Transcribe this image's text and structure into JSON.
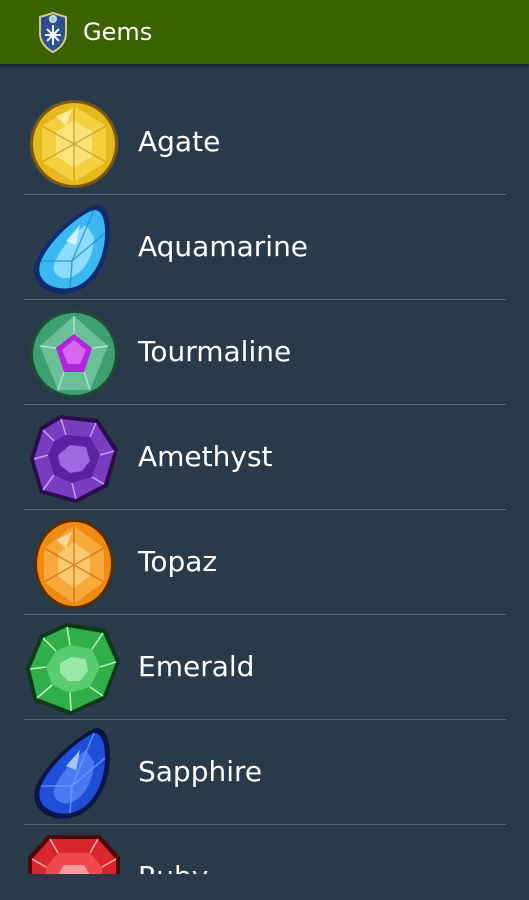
{
  "app": {
    "title": "Gems",
    "icon": "shield-emblem-icon"
  },
  "colors": {
    "appbar": "#3a6200",
    "background": "#293b4b",
    "divider": "#56687a",
    "text": "#ffffff"
  },
  "gems": [
    {
      "label": "Agate",
      "icon": "agate-gem-icon",
      "color": "#e6b820"
    },
    {
      "label": "Aquamarine",
      "icon": "aquamarine-gem-icon",
      "color": "#3cb8f0"
    },
    {
      "label": "Tourmaline",
      "icon": "tourmaline-gem-icon",
      "color": "#3ea070"
    },
    {
      "label": "Amethyst",
      "icon": "amethyst-gem-icon",
      "color": "#7a3cc0"
    },
    {
      "label": "Topaz",
      "icon": "topaz-gem-icon",
      "color": "#ef8a14"
    },
    {
      "label": "Emerald",
      "icon": "emerald-gem-icon",
      "color": "#2fae4a"
    },
    {
      "label": "Sapphire",
      "icon": "sapphire-gem-icon",
      "color": "#1f4fd6"
    },
    {
      "label": "Ruby",
      "icon": "ruby-gem-icon",
      "color": "#d8262c"
    }
  ]
}
